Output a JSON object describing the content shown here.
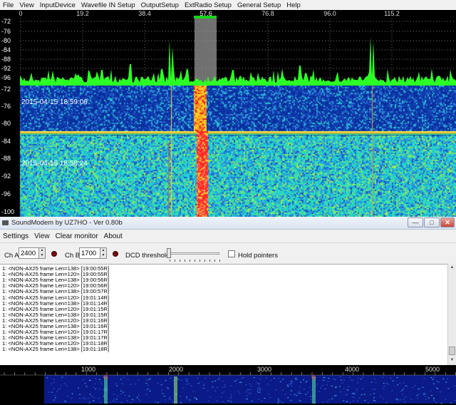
{
  "sdr": {
    "menu": [
      "File",
      "View",
      "InputDevice",
      "Wavefile IN Setup",
      "OutputSetup",
      "ExtRadio Setup",
      "General Setup",
      "Help"
    ],
    "freq_ticks": [
      "0",
      "19.2",
      "38.4",
      "57.6",
      "76.8",
      "96.0",
      "115.2"
    ],
    "spectrum_db_labels": [
      "-72",
      "-76",
      "-80",
      "-84",
      "-88",
      "-92",
      "-96"
    ],
    "waterfall_db_labels": [
      "-72",
      "-76",
      "-80",
      "-84",
      "-88",
      "-92",
      "-96",
      "-100"
    ],
    "waterfall_timestamps": [
      "2015-04-15 18:59:06",
      "2015-04-15 18:58:24"
    ],
    "colors": {
      "spectrum_trace": "#2cff26",
      "passband": "#16d61a",
      "grid": "#9a9a9a"
    }
  },
  "soundmodem": {
    "title": "SoundModem by UZ7HO - Ver 0.80b",
    "menu": [
      "Settings",
      "View",
      "Clear monitor",
      "About"
    ],
    "cha_label": "Ch A",
    "cha_value": "2400",
    "chb_label": "Ch B",
    "chb_value": "1700",
    "dcd_label": "DCD threshold",
    "hold_label": "Hold pointers",
    "monitor_lines": [
      "1: <NON-AX25 frame Len=138> [19:00:55R]",
      "1: <NON-AX25 frame Len=120> [19:00:55R]",
      "1: <NON-AX25 frame Len=138> [19:00:56R]",
      "1: <NON-AX25 frame Len=120> [19:00:56R]",
      "1: <NON-AX25 frame Len=138> [19:00:57R]",
      "1: <NON-AX25 frame Len=120> [19:01:14R]",
      "1: <NON-AX25 frame Len=138> [19:01:14R]",
      "1: <NON-AX25 frame Len=120> [19:01:15R]",
      "1: <NON-AX25 frame Len=138> [19:01:15R]",
      "1: <NON-AX25 frame Len=120> [19:01:16R]",
      "1: <NON-AX25 frame Len=138> [19:01:16R]",
      "1: <NON-AX25 frame Len=120> [19:01:17R]",
      "1: <NON-AX25 frame Len=138> [19:01:17R]",
      "1: <NON-AX25 frame Len=120> [19:01:18R]",
      "1: <NON-AX25 frame Len=138> [19:01:18R]"
    ],
    "waterfall_ticks": [
      "1000",
      "2000",
      "3000",
      "4000",
      "5000"
    ]
  }
}
